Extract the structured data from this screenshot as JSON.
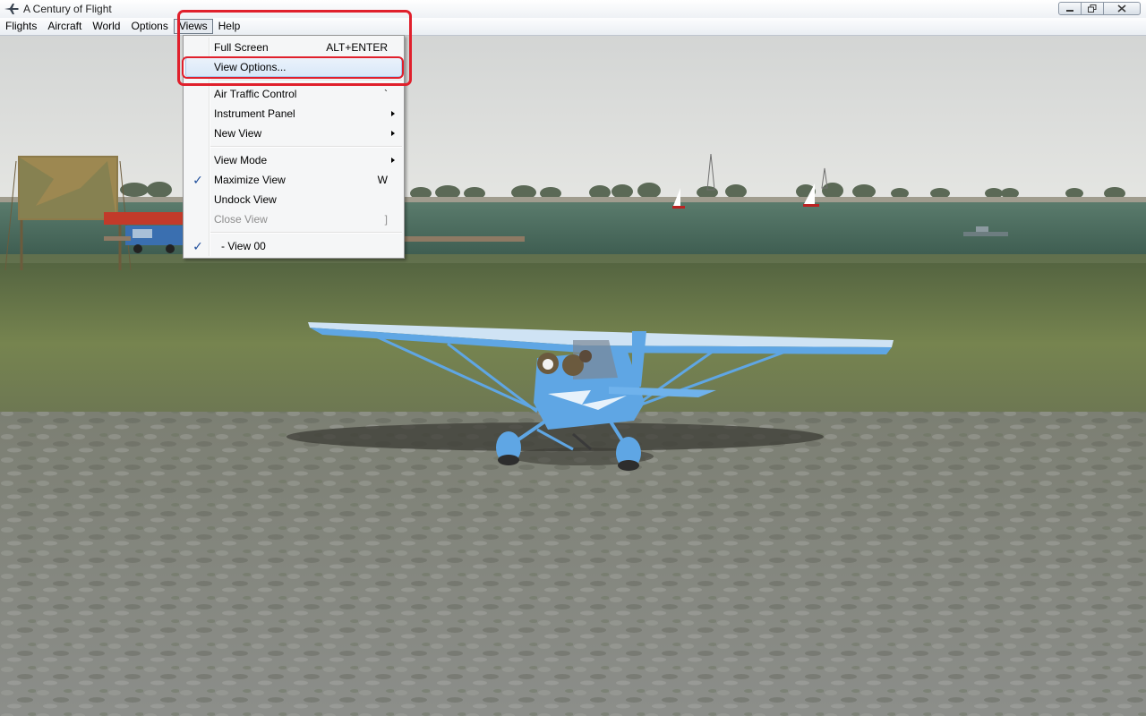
{
  "window": {
    "title": "A Century of Flight",
    "app_icon": "airplane-icon",
    "controls": {
      "minimize_icon": "minimize-icon",
      "maximize_icon": "restore-icon",
      "close_icon": "close-icon"
    }
  },
  "menubar": {
    "items": [
      {
        "label": "Flights"
      },
      {
        "label": "Aircraft"
      },
      {
        "label": "World"
      },
      {
        "label": "Options"
      },
      {
        "label": "Views"
      },
      {
        "label": "Help"
      }
    ]
  },
  "views_menu": {
    "items": [
      {
        "label": "Full Screen",
        "shortcut": "ALT+ENTER"
      },
      {
        "label": "View Options...",
        "shortcut": ""
      },
      {
        "label": "Air Traffic Control",
        "shortcut": "`"
      },
      {
        "label": "Instrument Panel",
        "submenu": true
      },
      {
        "label": "New View",
        "submenu": true
      },
      {
        "label": "View Mode",
        "submenu": true
      },
      {
        "label": "Maximize View",
        "shortcut": "W",
        "checked": true
      },
      {
        "label": "Undock View",
        "shortcut": ""
      },
      {
        "label": "Close View",
        "shortcut": "]",
        "disabled": true
      },
      {
        "label": "- View 00",
        "checked": true
      }
    ],
    "check_icon": "checkmark-icon",
    "submenu_icon": "chevron-right-icon"
  },
  "colors": {
    "annotation": "#e0202c",
    "menu_hover": "#d9e8f8",
    "check": "#1f4e9b",
    "sky": "#dcdedd",
    "water": "#4d6f61",
    "grass": "#6e7d4f",
    "ground": "#8a8c85",
    "plane": "#5fa6e4"
  }
}
